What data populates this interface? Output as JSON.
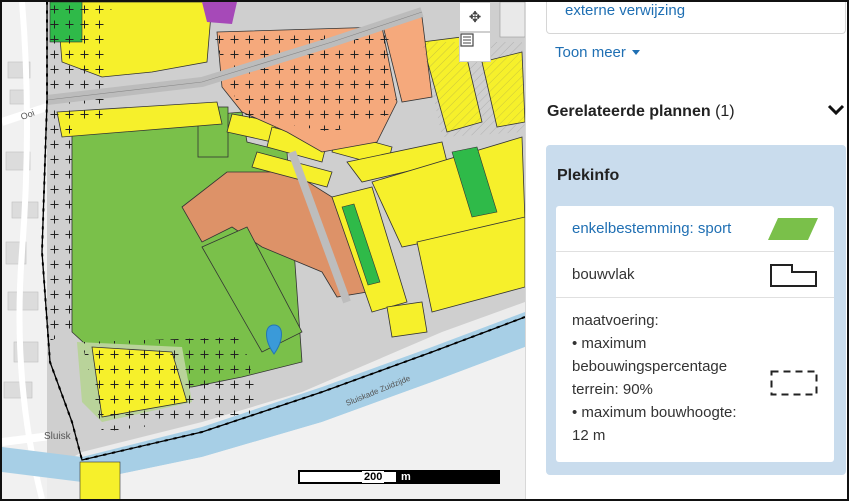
{
  "map": {
    "street_label_1": "Sluiskade Zuidzijde",
    "street_label_2": "Sluisk",
    "street_label_3": "Ooi",
    "pan_icon": "pan-move-icon",
    "legend_icon": "layers-legend-icon",
    "scale_value": "200",
    "scale_unit": "m",
    "colors": {
      "sport": "#7ac04a",
      "wonen": "#f6f02b",
      "maatschappelijk": "#f5a97c",
      "gemengd": "#dd9268",
      "water": "#a7cfe6",
      "verkeer": "#cfcfcf",
      "groen": "#2fba49",
      "purple": "#a649b8"
    }
  },
  "panel": {
    "external_link": "externe verwijzing",
    "show_more": "Toon meer",
    "related_plans_title": "Gerelateerde plannen",
    "related_plans_count": "(1)",
    "plekinfo_title": "Plekinfo",
    "items": [
      {
        "label": "enkelbestemming: sport",
        "symbol": "sport-parallelogram-icon"
      },
      {
        "label": "bouwvlak",
        "symbol": "bouwvlak-outline-icon"
      },
      {
        "label_lines": [
          "maatvoering:",
          "• maximum",
          "bebouwingspercentage",
          "terrein: 90%",
          "• maximum bouwhoogte:",
          "12 m"
        ],
        "symbol": "dashed-rectangle-icon"
      }
    ]
  }
}
